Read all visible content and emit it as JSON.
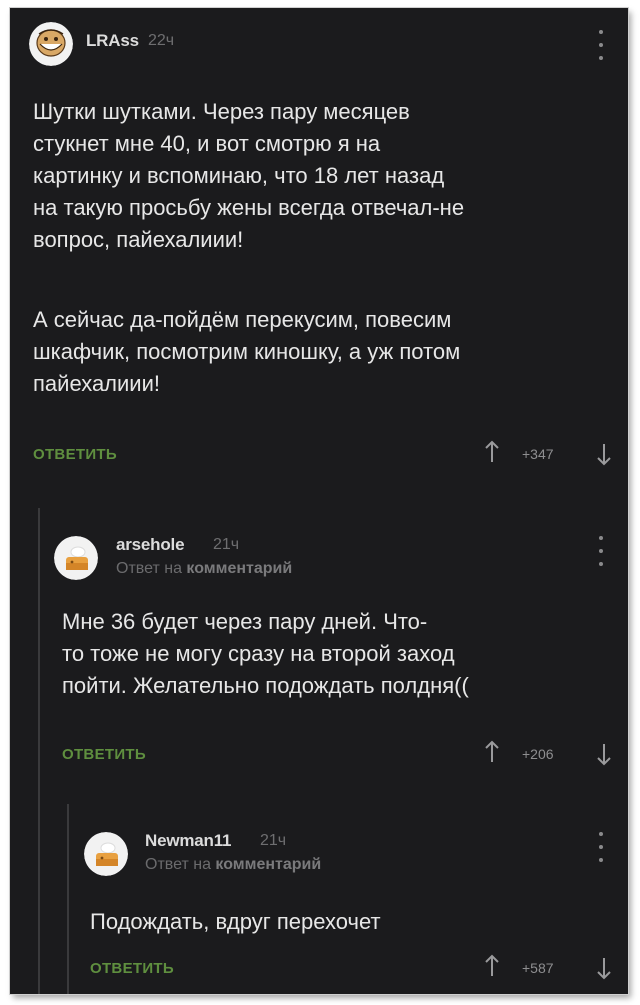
{
  "comments": [
    {
      "username": "LRAss",
      "time": "22ч",
      "paragraphs": [
        "Шутки шутками. Через пару месяцев\nстукнет мне 40, и вот смотрю я на\nкартинку и вспоминаю, что 18 лет назад\nна такую просьбу жены всегда отвечал-не\nвопрос, пайехалиии!",
        "А сейчас да-пойдём перекусим, повесим\nшкафчик, посмотрим киношку, а уж потом\nпайехалиии!"
      ],
      "reply_label": "ОТВЕТИТЬ",
      "rating": "+347"
    },
    {
      "username": "arsehole",
      "time": "21ч",
      "reply_to_prefix": "Ответ на",
      "reply_to_target": "комментарий",
      "text": "Мне 36 будет через пару дней. Что-\nто тоже не могу сразу на второй заход\nпойти. Желательно подождать полдня((",
      "reply_label": "ОТВЕТИТЬ",
      "rating": "+206"
    },
    {
      "username": "Newman11",
      "time": "21ч",
      "reply_to_prefix": "Ответ на",
      "reply_to_target": "комментарий",
      "text": "Подождать, вдруг перехочет",
      "reply_label": "ОТВЕТИТЬ",
      "rating": "+587"
    }
  ],
  "colors": {
    "background": "#1b1b1d",
    "text": "#e7e7e7",
    "reply_button": "#5f8f3f",
    "muted": "#6e6e70"
  },
  "icons": {
    "upvote": "arrow-up-icon",
    "downvote": "arrow-down-icon",
    "menu": "more-vertical-icon"
  }
}
